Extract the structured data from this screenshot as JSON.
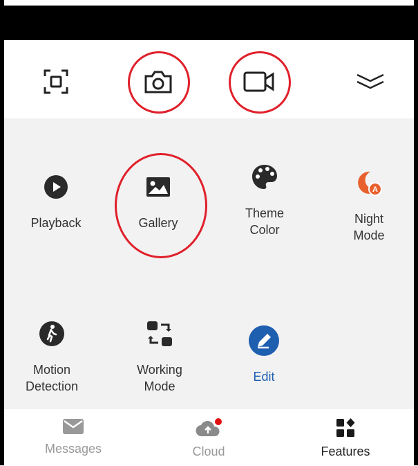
{
  "toolbar": {
    "items": [
      {
        "icon": "fullscreen-icon",
        "circled": false
      },
      {
        "icon": "camera-icon",
        "circled": true
      },
      {
        "icon": "video-icon",
        "circled": true
      },
      {
        "icon": "collapse-chevrons-icon",
        "circled": false
      }
    ]
  },
  "features": {
    "playback": {
      "label": "Playback",
      "icon": "play-icon"
    },
    "gallery": {
      "label": "Gallery",
      "icon": "image-icon"
    },
    "theme_color": {
      "label": "Theme\nColor",
      "icon": "palette-icon"
    },
    "night_mode": {
      "label": "Night\nMode",
      "icon": "night-mode-icon"
    },
    "motion_detection": {
      "label": "Motion\nDetection",
      "icon": "walking-person-icon"
    },
    "working_mode": {
      "label": "Working\nMode",
      "icon": "working-mode-icon"
    },
    "edit": {
      "label": "Edit",
      "icon": "pencil-icon"
    }
  },
  "bottom_nav": {
    "messages": {
      "label": "Messages",
      "icon": "envelope-icon"
    },
    "cloud": {
      "label": "Cloud",
      "icon": "cloud-icon",
      "badge": true
    },
    "features": {
      "label": "Features",
      "icon": "features-grid-icon",
      "active": true
    }
  },
  "colors": {
    "annotation_red": "#e0202a",
    "accent_blue": "#1f5fb0",
    "night_mode_orange": "#e8602c",
    "grid_background": "#f2f2f2"
  }
}
